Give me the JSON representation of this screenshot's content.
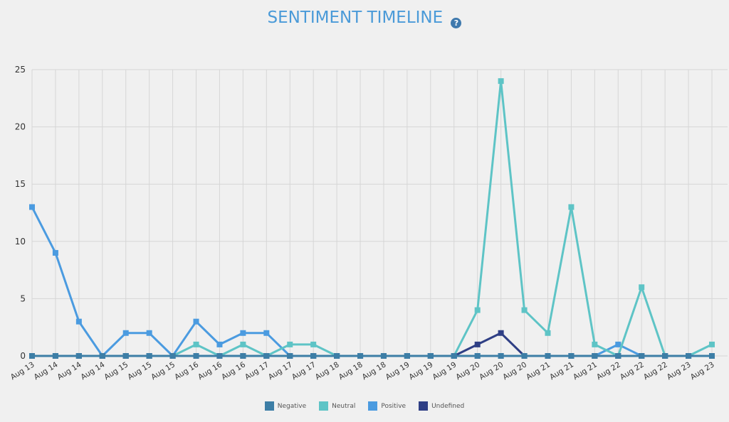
{
  "header": {
    "title": "SENTIMENT TIMELINE",
    "help_icon": "?"
  },
  "chart_data": {
    "type": "line",
    "title": "SENTIMENT TIMELINE",
    "xlabel": "",
    "ylabel": "",
    "ylim": [
      0,
      25
    ],
    "yticks": [
      0,
      5,
      10,
      15,
      20,
      25
    ],
    "grid": true,
    "legend_position": "bottom",
    "categories": [
      "Aug 13",
      "Aug 14",
      "Aug 14",
      "Aug 14",
      "Aug 15",
      "Aug 15",
      "Aug 15",
      "Aug 16",
      "Aug 16",
      "Aug 16",
      "Aug 17",
      "Aug 17",
      "Aug 17",
      "Aug 18",
      "Aug 18",
      "Aug 18",
      "Aug 19",
      "Aug 19",
      "Aug 19",
      "Aug 20",
      "Aug 20",
      "Aug 20",
      "Aug 21",
      "Aug 21",
      "Aug 21",
      "Aug 22",
      "Aug 22",
      "Aug 22",
      "Aug 23",
      "Aug 23"
    ],
    "series": [
      {
        "name": "Negative",
        "color": "#3d7ea6",
        "values": [
          0,
          0,
          0,
          0,
          0,
          0,
          0,
          0,
          0,
          0,
          0,
          0,
          0,
          0,
          0,
          0,
          0,
          0,
          0,
          0,
          0,
          0,
          0,
          0,
          0,
          0,
          0,
          0,
          0,
          0
        ]
      },
      {
        "name": "Neutral",
        "color": "#5ec4c6",
        "values": [
          0,
          0,
          0,
          0,
          0,
          0,
          0,
          1,
          0,
          1,
          0,
          1,
          1,
          0,
          0,
          0,
          0,
          0,
          0,
          4,
          24,
          4,
          2,
          13,
          1,
          0,
          6,
          0,
          0,
          1
        ]
      },
      {
        "name": "Positive",
        "color": "#4b9be0",
        "values": [
          13,
          9,
          3,
          0,
          2,
          2,
          0,
          3,
          1,
          2,
          2,
          0,
          0,
          0,
          0,
          0,
          0,
          0,
          0,
          0,
          0,
          0,
          0,
          0,
          0,
          1,
          0,
          0,
          0,
          0
        ]
      },
      {
        "name": "Undefined",
        "color": "#2f3f85",
        "values": [
          0,
          0,
          0,
          0,
          0,
          0,
          0,
          0,
          0,
          0,
          0,
          0,
          0,
          0,
          0,
          0,
          0,
          0,
          0,
          1,
          2,
          0,
          0,
          0,
          0,
          0,
          0,
          0,
          0,
          0
        ]
      }
    ]
  }
}
